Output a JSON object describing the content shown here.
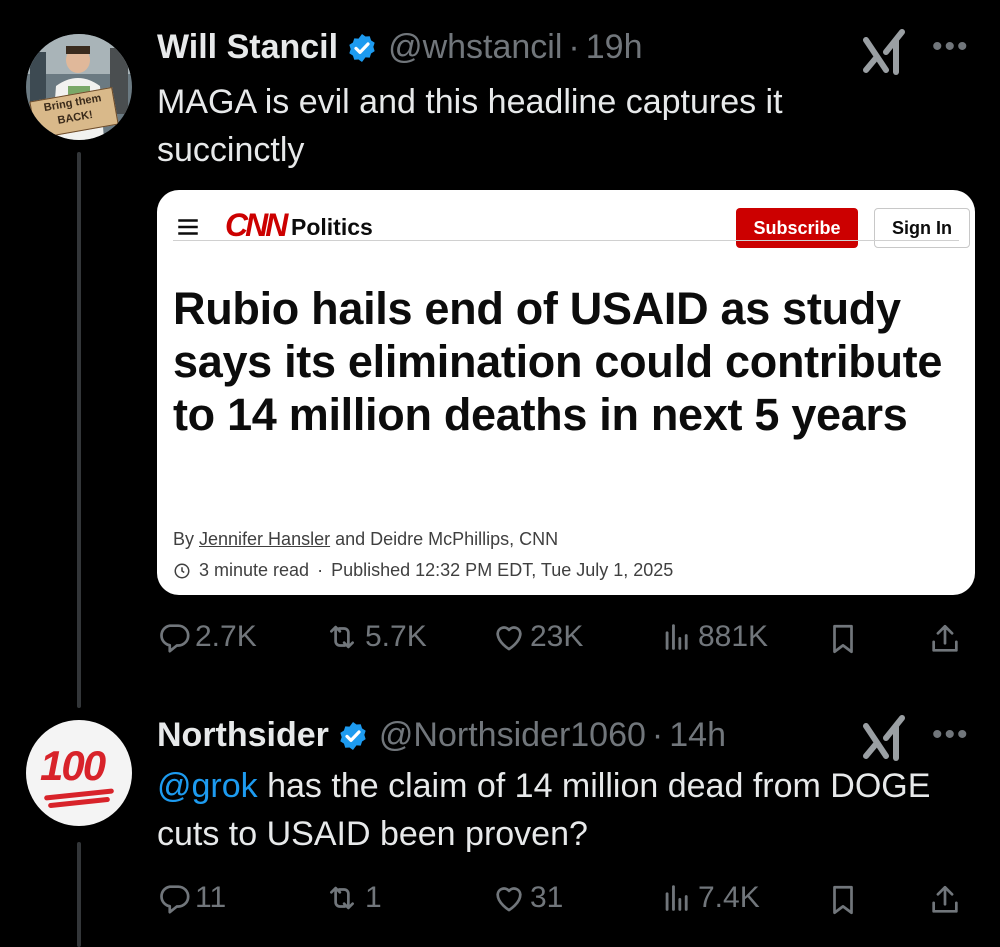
{
  "tweets": [
    {
      "name": "Will Stancil",
      "handle": "@whstancil",
      "time": "19h",
      "text": "MAGA is evil and this headline captures it succinctly",
      "avatar_sign_text": "Bring them BACK!",
      "stats": {
        "replies": "2.7K",
        "reposts": "5.7K",
        "likes": "23K",
        "views": "881K"
      }
    },
    {
      "name": "Northsider",
      "handle": "@Northsider1060",
      "time": "14h",
      "mention": "@grok",
      "text": " has the claim of 14 million dead from DOGE cuts to USAID been proven?",
      "avatar_text": "100",
      "stats": {
        "replies": "11",
        "reposts": "1",
        "likes": "31",
        "views": "7.4K"
      }
    }
  ],
  "card": {
    "brand": "CNN",
    "section": "Politics",
    "subscribe": "Subscribe",
    "sign_in": "Sign In",
    "headline": "Rubio hails end of USAID as study says its elimination could contribute to 14 million deaths in next 5 years",
    "byline_prefix": "By ",
    "author1": "Jennifer Hansler",
    "byline_rest": " and Deidre McPhillips, CNN",
    "read_time": "3 minute read",
    "published": "Published 12:32 PM EDT, Tue July 1, 2025"
  },
  "colors": {
    "accent": "#1d9bf0",
    "cnn_red": "#cc0000",
    "muted": "#71767b"
  },
  "icons": [
    "verified-icon",
    "grok-icon",
    "more-icon",
    "reply-icon",
    "repost-icon",
    "like-icon",
    "views-icon",
    "bookmark-icon",
    "share-icon",
    "menu-icon",
    "clock-icon"
  ]
}
